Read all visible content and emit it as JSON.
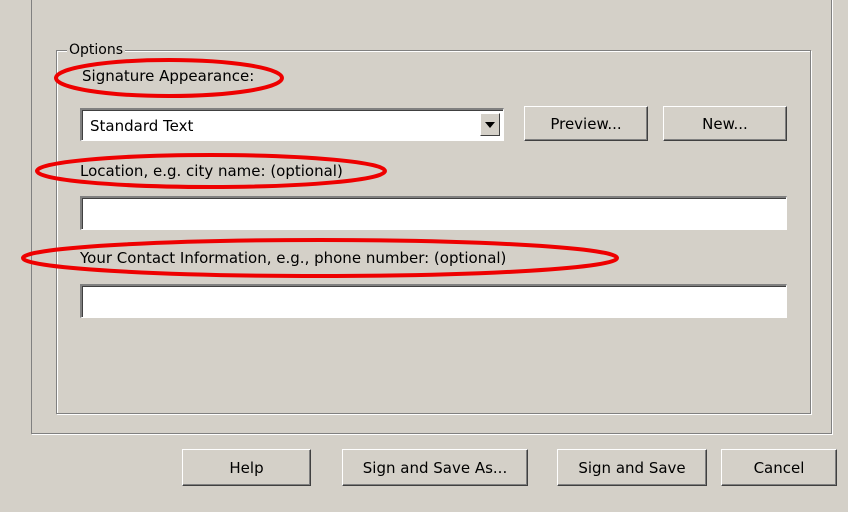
{
  "options_group": {
    "legend": "Options"
  },
  "signature_appearance": {
    "label": "Signature Appearance:",
    "selected": "Standard Text",
    "preview_button": "Preview...",
    "new_button": "New..."
  },
  "location": {
    "label": "Location, e.g. city name: (optional)",
    "value": ""
  },
  "contact": {
    "label": "Your Contact Information, e.g., phone number: (optional)",
    "value": ""
  },
  "footer_buttons": {
    "help": "Help",
    "sign_and_save_as": "Sign and Save As...",
    "sign_and_save": "Sign and Save",
    "cancel": "Cancel"
  },
  "annotation_color": "#ee0000"
}
